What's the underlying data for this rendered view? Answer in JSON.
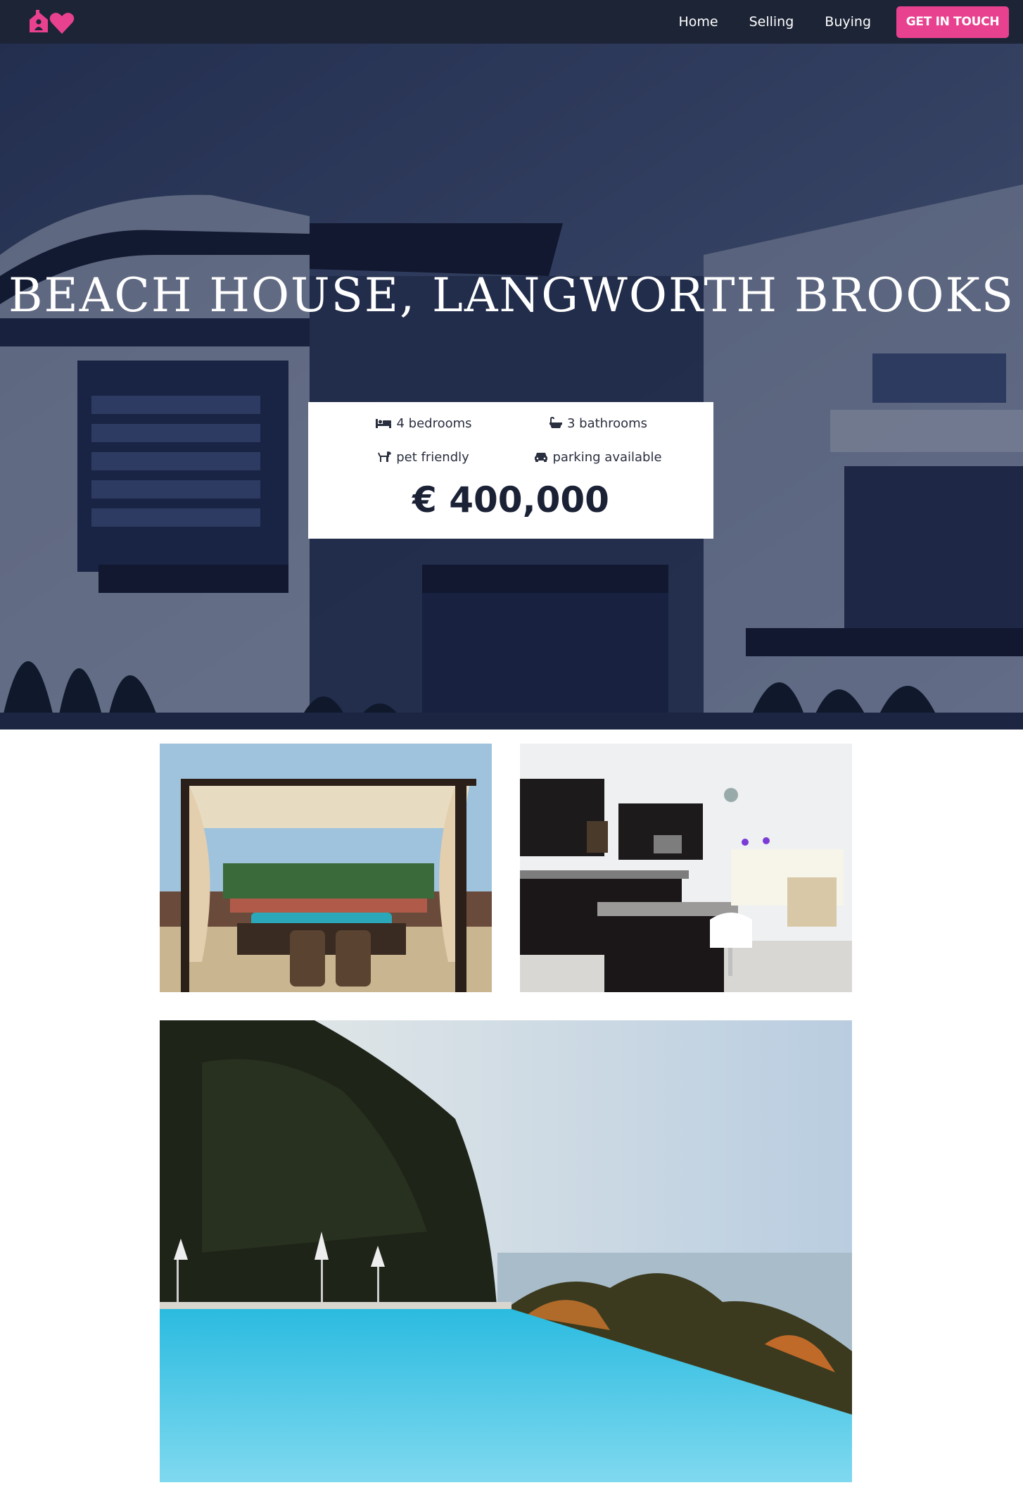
{
  "brand": {
    "logo_icon": "house-heart-icon",
    "accent_color": "#e8418f"
  },
  "nav": {
    "links": [
      "Home",
      "Selling",
      "Buying"
    ],
    "cta_label": "GET IN TOUCH"
  },
  "hero": {
    "title": "BEACH HOUSE, LANGWORTH BROOKS",
    "background_color": "#1c2436"
  },
  "listing": {
    "features": [
      {
        "icon": "bed-icon",
        "label": "4 bedrooms"
      },
      {
        "icon": "bath-icon",
        "label": "3 bathrooms"
      },
      {
        "icon": "dog-icon",
        "label": "pet friendly"
      },
      {
        "icon": "car-icon",
        "label": "parking available"
      }
    ],
    "price": "€ 400,000"
  },
  "gallery": {
    "photos": [
      "patio-cabana-photo",
      "kitchen-photo",
      "infinity-pool-photo"
    ]
  }
}
